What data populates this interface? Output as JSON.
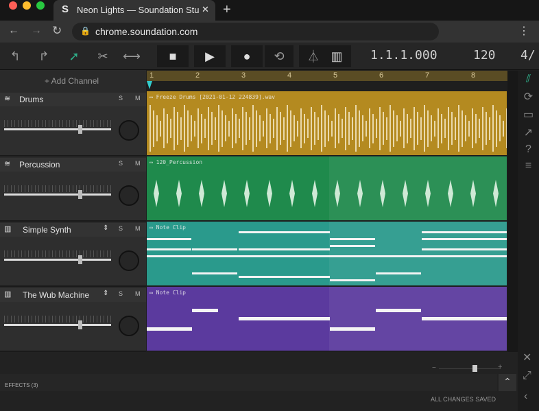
{
  "browser": {
    "tab_title": "Neon Lights — Soundation Stu",
    "url": "chrome.soundation.com"
  },
  "transport": {
    "position": "1.1.1.000",
    "tempo": "120",
    "signature": "4/"
  },
  "left": {
    "add_channel": "+ Add Channel"
  },
  "tracks": [
    {
      "name": "Drums",
      "solo": "S",
      "mute": "M",
      "clip": "Freeze Drums [2021-01-12 224839].wav",
      "color": "#b48a20"
    },
    {
      "name": "Percussion",
      "solo": "S",
      "mute": "M",
      "clip": "120_Percussion",
      "color": "#1f8a4c"
    },
    {
      "name": "Simple Synth",
      "solo": "S",
      "mute": "M",
      "clip": "Note Clip",
      "color": "#2a9a8c"
    },
    {
      "name": "The Wub Machine",
      "solo": "S",
      "mute": "M",
      "clip": "Note Clip",
      "color": "#5b3a9e"
    }
  ],
  "ruler": [
    "1",
    "2",
    "3",
    "4",
    "5",
    "6",
    "7",
    "8"
  ],
  "footer": {
    "effects": "EFFECTS (3)",
    "status": "ALL CHANGES SAVED"
  }
}
